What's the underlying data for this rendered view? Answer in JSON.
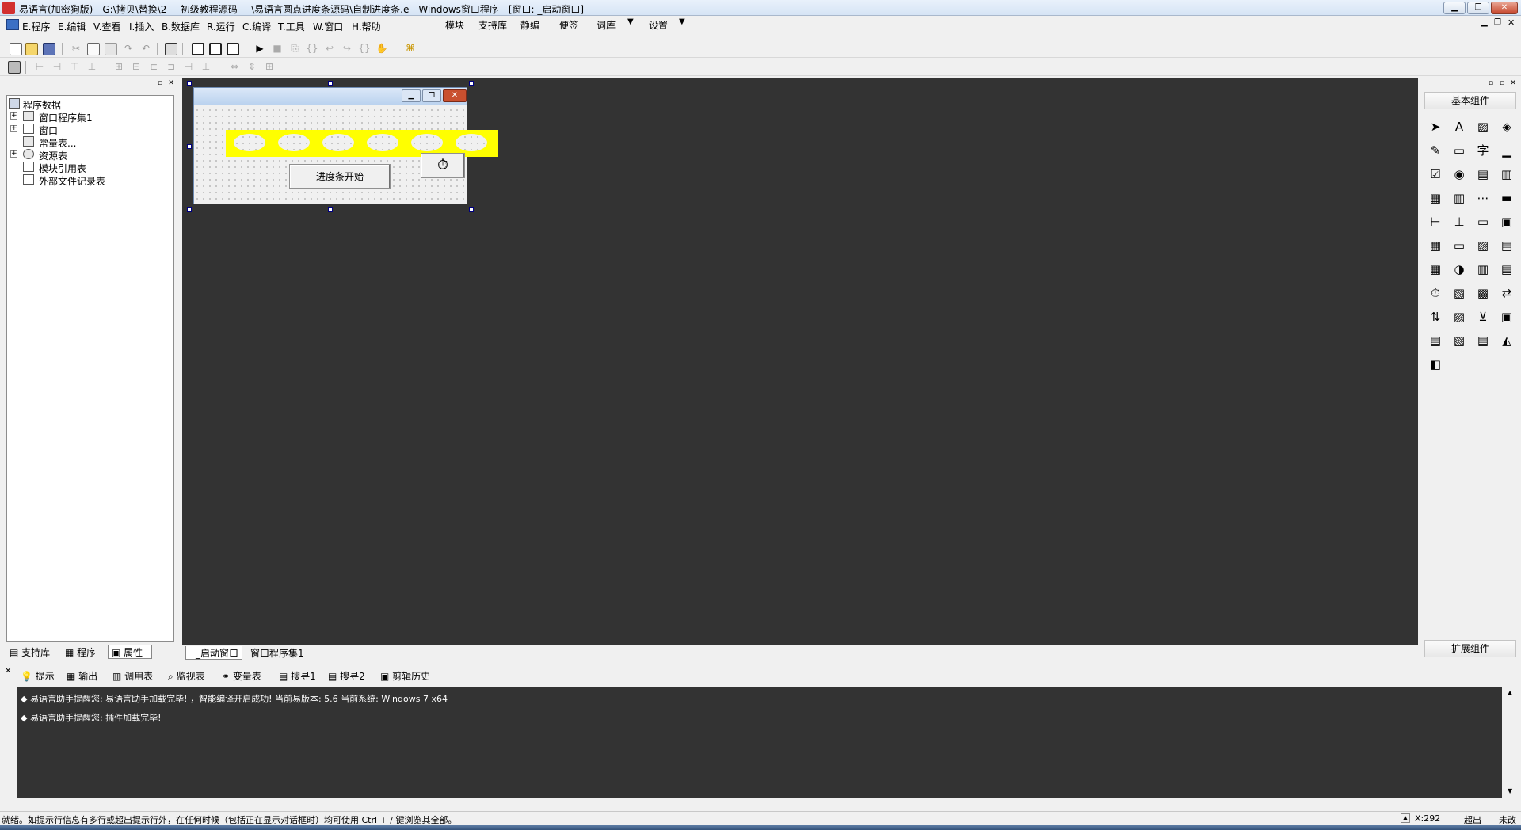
{
  "window": {
    "title": "易语言(加密狗版) - G:\\拷贝\\替换\\2----初级教程源码----\\易语言圆点进度条源码\\自制进度条.e - Windows窗口程序 - [窗口: _启动窗口]"
  },
  "menu": [
    "E.程序",
    "E.编辑",
    "V.查看",
    "I.插入",
    "B.数据库",
    "R.运行",
    "C.编译",
    "T.工具",
    "W.窗口",
    "H.帮助"
  ],
  "menu_right": [
    "模块",
    "支持库",
    "静编",
    "便签",
    "词库",
    "设置"
  ],
  "tree": {
    "root": "程序数据",
    "items": [
      "窗口程序集1",
      "窗口",
      "常量表...",
      "资源表",
      "模块引用表",
      "外部文件记录表"
    ]
  },
  "left_tabs": [
    "支持库",
    "程序",
    "属性"
  ],
  "form": {
    "button_label": "进度条开始",
    "timer_glyph": "⏱"
  },
  "doc_tabs": [
    "_启动窗口",
    "窗口程序集1"
  ],
  "right_panel": {
    "basic_label": "基本组件",
    "ext_label": "扩展组件"
  },
  "output_tabs": [
    "提示",
    "输出",
    "调用表",
    "监视表",
    "变量表",
    "搜寻1",
    "搜寻2",
    "剪辑历史"
  ],
  "output_lines": [
    "◆ 易语言助手提醒您: 易语言助手加载完毕!  ，智能编译开启成功!  当前易版本: 5.6  当前系统: Windows 7 x64",
    "◆ 易语言助手提醒您: 插件加载完毕!"
  ],
  "status": {
    "text": "就绪。如提示行信息有多行或超出提示行外，在任何时候（包括正在显示对话框时）均可使用 Ctrl + / 键浏览其全部。",
    "coord": "X:292",
    "overwrite": "超出",
    "modified": "未改"
  },
  "colors": {
    "workspace": "#333333",
    "progress_fill": "#ffff00",
    "titlebar": "#d6e4f5"
  }
}
